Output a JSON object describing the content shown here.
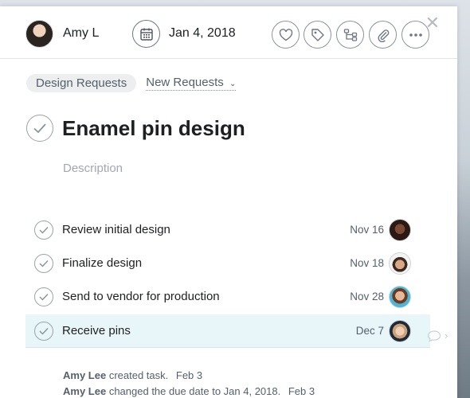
{
  "header": {
    "assignee": "Amy L",
    "due_date": "Jan 4, 2018"
  },
  "project": "Design Requests",
  "section": "New Requests",
  "task": {
    "title": "Enamel pin design",
    "description_placeholder": "Description"
  },
  "subtasks": [
    {
      "name": "Review initial design",
      "date": "Nov 16"
    },
    {
      "name": "Finalize design",
      "date": "Nov 18"
    },
    {
      "name": "Send to vendor for production",
      "date": "Nov 28"
    },
    {
      "name": "Receive pins",
      "date": "Dec 7"
    }
  ],
  "activity": [
    {
      "user": "Amy Lee",
      "action": "created task.",
      "when": "Feb 3"
    },
    {
      "user": "Amy Lee",
      "action": "changed the due date to Jan 4, 2018.",
      "when": "Feb 3"
    }
  ],
  "icons": {
    "close": "close-icon",
    "calendar": "calendar-icon",
    "like": "heart-icon",
    "tags": "tag-icon",
    "subtasks": "subtask-icon",
    "attach": "paperclip-icon",
    "more": "more-icon",
    "complete": "check-icon",
    "comment": "comment-icon"
  },
  "colors": {
    "text": "#1e1f21",
    "muted": "#56606b",
    "highlight_row": "#e8f6fa"
  }
}
